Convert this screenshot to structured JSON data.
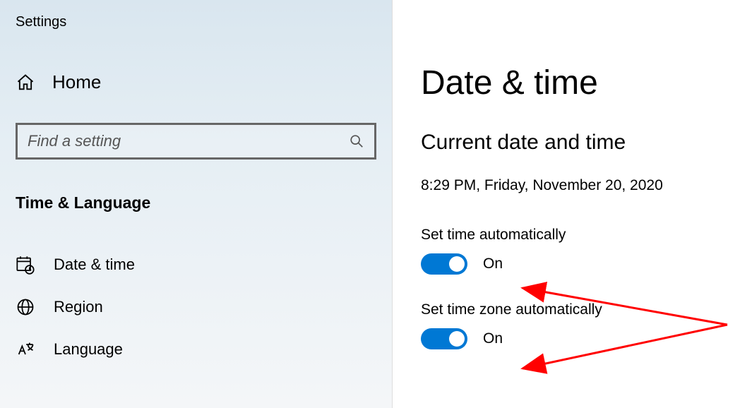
{
  "app_title": "Settings",
  "home_label": "Home",
  "search": {
    "placeholder": "Find a setting"
  },
  "category": "Time & Language",
  "nav": {
    "date_time": "Date & time",
    "region": "Region",
    "language": "Language"
  },
  "page": {
    "title": "Date & time",
    "section_title": "Current date and time",
    "current_datetime": "8:29 PM, Friday, November 20, 2020",
    "set_time_label": "Set time automatically",
    "set_time_state": "On",
    "set_tz_label": "Set time zone automatically",
    "set_tz_state": "On"
  },
  "colors": {
    "accent": "#0078d4",
    "arrow": "#ff0000"
  }
}
